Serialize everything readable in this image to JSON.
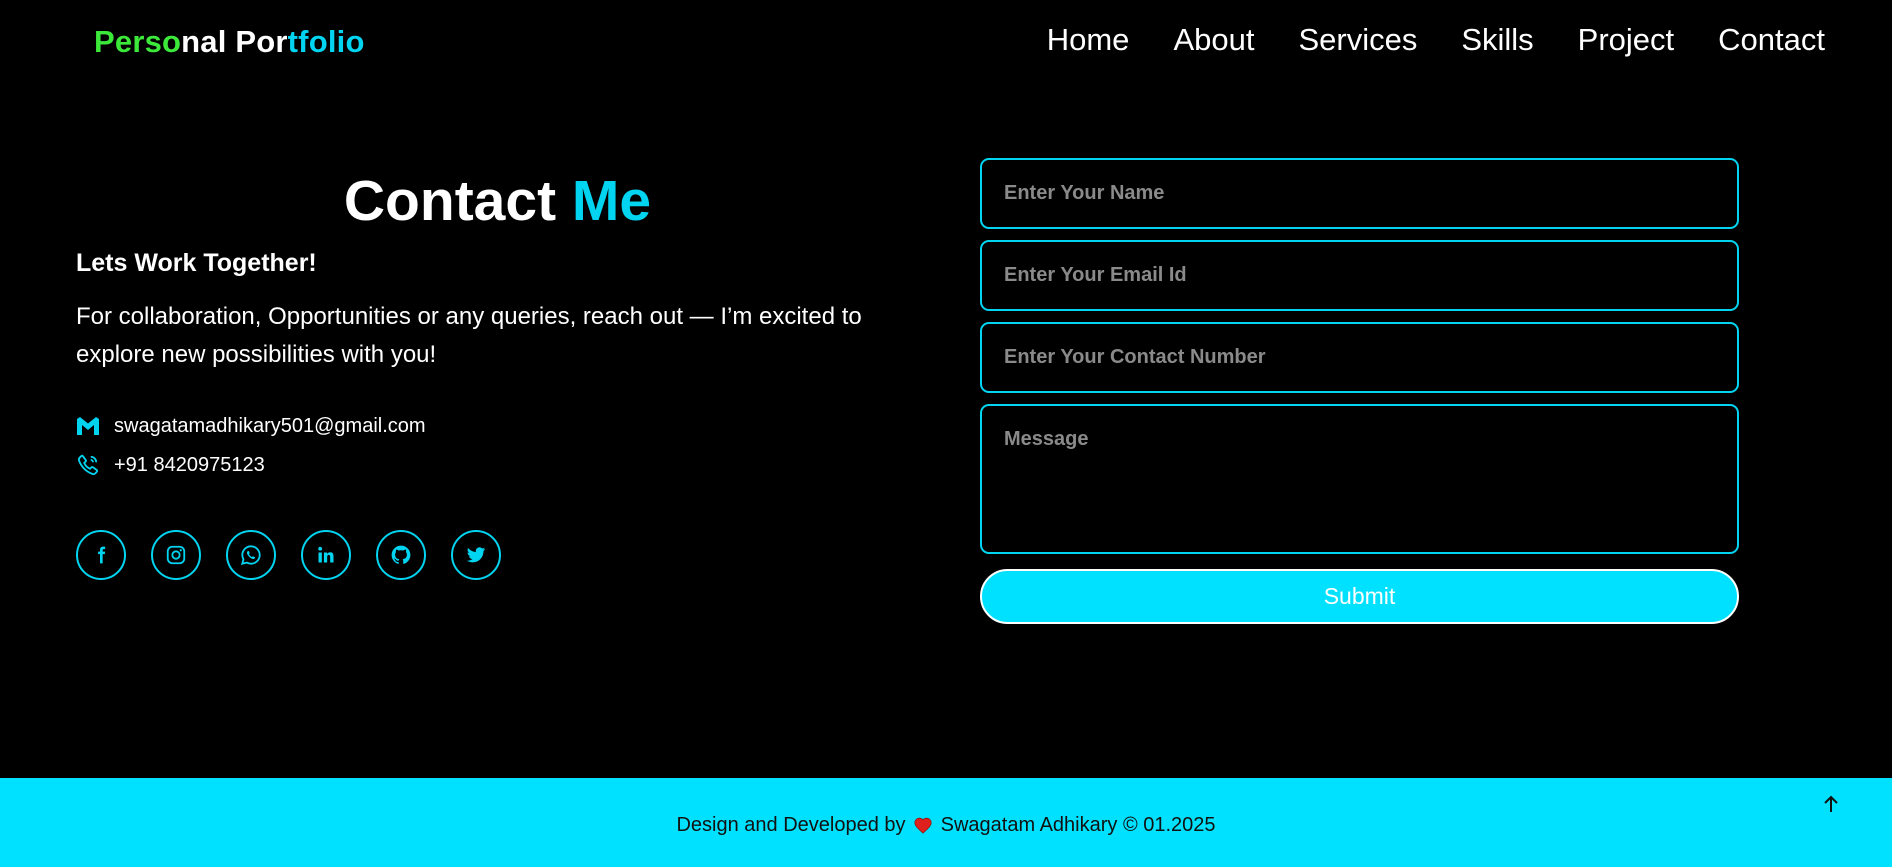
{
  "brand": {
    "part1": "Perso",
    "part2": "nal Por",
    "part3": "tfolio",
    "colors": {
      "green": "#3ce83a",
      "white": "#ffffff",
      "cyan": "#00d4f0"
    }
  },
  "nav": {
    "items": [
      "Home",
      "About",
      "Services",
      "Skills",
      "Project",
      "Contact"
    ]
  },
  "contact": {
    "title": "Contact",
    "title_accent": "Me",
    "subtitle": "Lets Work Together!",
    "description": "For collaboration, Opportunities or any queries, reach out — I’m excited to explore new possibilities with you!",
    "email": "swagatamadhikary501@gmail.com",
    "phone": "+91 8420975123",
    "email_icon": "gmail-icon",
    "phone_icon": "phone-icon"
  },
  "socials": [
    "facebook-icon",
    "instagram-icon",
    "whatsapp-icon",
    "linkedin-icon",
    "github-icon",
    "twitter-icon"
  ],
  "form": {
    "name_placeholder": "Enter Your Name",
    "email_placeholder": "Enter Your Email Id",
    "contact_placeholder": "Enter Your Contact Number",
    "message_placeholder": "Message",
    "submit_label": "Submit"
  },
  "footer": {
    "prefix": "Design and Developed by",
    "suffix": "Swagatam Adhikary © 01.2025",
    "heart_icon": "heart-icon",
    "to_top_icon": "arrow-up-icon"
  },
  "theme": {
    "accent": "#00d4f0",
    "footer_bg": "#00e1ff",
    "background": "#000000"
  }
}
